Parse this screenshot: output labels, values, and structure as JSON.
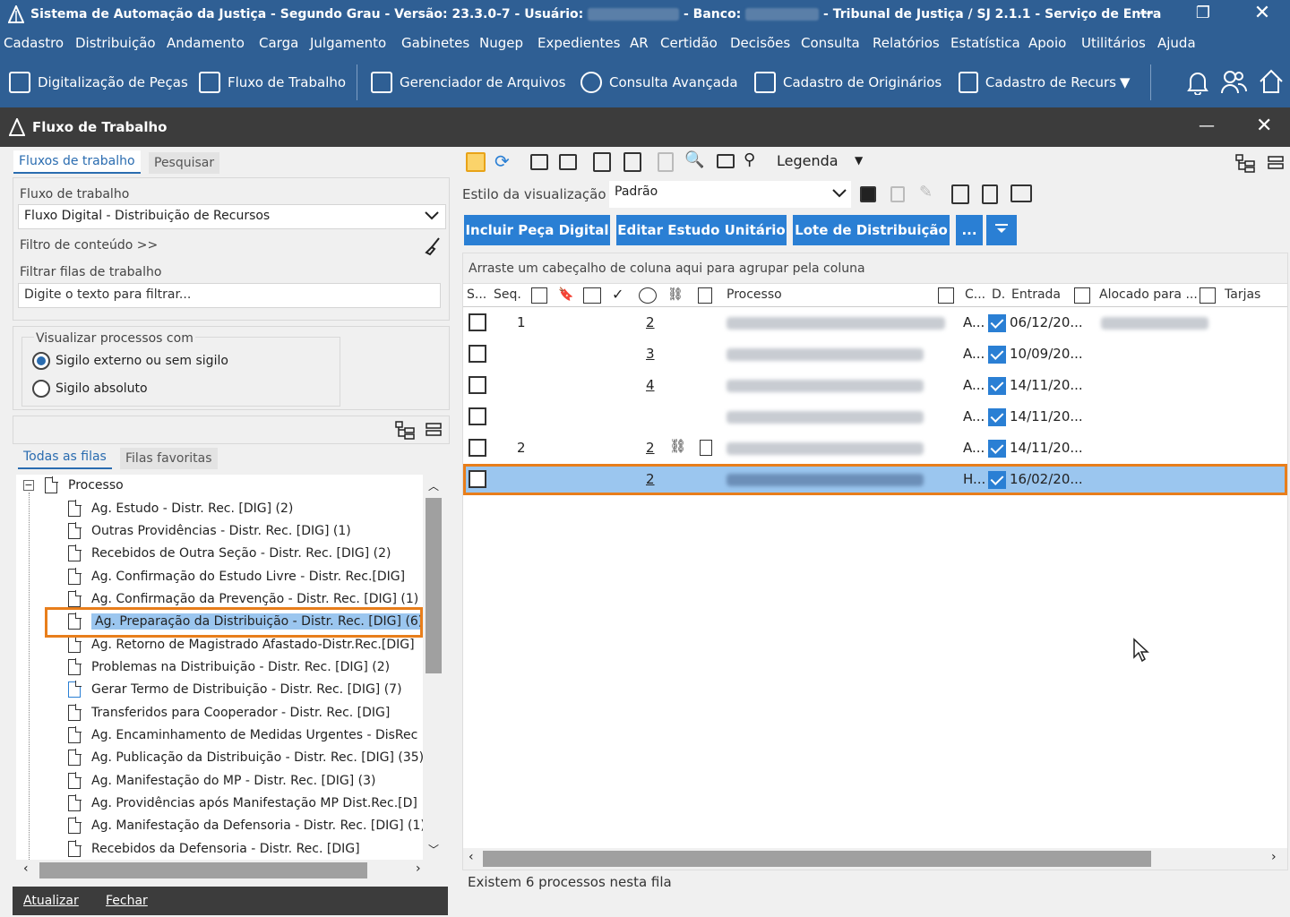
{
  "window": {
    "title_prefix": "Sistema de Automação da Justiça - Segundo Grau - Versão: 23.3.0-7 - Usuário:",
    "title_mid": "- Banco:",
    "title_suffix": "- Tribunal de Justiça / SJ 2.1.1 - Serviço de Entra",
    "minimize": "—",
    "restore": "❐",
    "close": "✕"
  },
  "menu": [
    "Cadastro",
    "Distribuição",
    "Andamento",
    "Carga",
    "Julgamento",
    "Gabinetes",
    "Nugep",
    "Expedientes",
    "AR",
    "Certidão",
    "Decisões",
    "Consulta",
    "Relatórios",
    "Estatística",
    "Apoio",
    "Utilitários",
    "Ajuda"
  ],
  "toolbar": {
    "items": [
      "Digitalização de Peças",
      "Fluxo de Trabalho",
      "Gerenciador de Arquivos",
      "Consulta Avançada",
      "Cadastro de Originários",
      "Cadastro de Recurs"
    ],
    "more": "▼"
  },
  "panel": {
    "title": "Fluxo de Trabalho",
    "min": "—",
    "close": "✕"
  },
  "left": {
    "tabs": [
      "Fluxos de trabalho",
      "Pesquisar"
    ],
    "fluxo_label": "Fluxo de trabalho",
    "fluxo_value": "Fluxo Digital - Distribuição de Recursos",
    "filtro_conteudo": "Filtro de conteúdo >>",
    "filtrar_label": "Filtrar filas de trabalho",
    "filtrar_placeholder": "Digite o texto para filtrar...",
    "visualizar_label": "Visualizar processos com",
    "radio1": "Sigilo externo ou sem sigilo",
    "radio2": "Sigilo absoluto",
    "queue_tabs": [
      "Todas as filas",
      "Filas favoritas"
    ],
    "tree_root": "Processo",
    "tree_items": [
      "Ag. Estudo - Distr. Rec. [DIG] (2)",
      "Outras Providências - Distr. Rec. [DIG] (1)",
      "Recebidos de Outra Seção - Distr. Rec. [DIG] (2)",
      "Ag. Confirmação do Estudo Livre - Distr. Rec.[DIG]",
      "Ag. Confirmação da Prevenção - Distr. Rec. [DIG] (1)",
      "Ag. Preparação da Distribuição - Distr. Rec. [DIG] (6)",
      "Ag. Retorno de Magistrado Afastado-Distr.Rec.[DIG]",
      "Problemas na Distribuição - Distr. Rec. [DIG] (2)",
      "Gerar Termo de Distribuição - Distr. Rec. [DIG] (7)",
      "Transferidos para Cooperador - Distr. Rec. [DIG]",
      "Ag. Encaminhamento de Medidas Urgentes - DisRec",
      "Ag. Publicação da Distribuição - Distr. Rec. [DIG] (35)",
      "Ag. Manifestação do MP - Distr. Rec. [DIG] (3)",
      "Ag. Providências após Manifestação MP Dist.Rec.[D]",
      "Ag. Manifestação da Defensoria - Distr. Rec. [DIG] (1)",
      "Recebidos da Defensoria - Distr. Rec. [DIG]"
    ],
    "footer_buttons": [
      "Atualizar",
      "Fechar"
    ]
  },
  "right": {
    "legenda": "Legenda",
    "estilo_label": "Estilo da visualização",
    "estilo_value": "Padrão",
    "buttons": [
      "Incluir Peça Digital",
      "Editar Estudo Unitário",
      "Lote de Distribuição",
      "..."
    ],
    "group_hint": "Arraste um cabeçalho de coluna aqui para agrupar pela coluna",
    "columns": {
      "s": "S...",
      "seq": "Seq.",
      "processo": "Processo",
      "c": "C...",
      "d": "D.",
      "entrada": "Entrada",
      "alocado": "Alocado para ...",
      "tarjas": "Tarjas"
    },
    "rows": [
      {
        "seq": "1",
        "num": "2",
        "c": "A...",
        "entrada": "06/12/20..."
      },
      {
        "seq": "",
        "num": "3",
        "c": "A...",
        "entrada": "10/09/20..."
      },
      {
        "seq": "",
        "num": "4",
        "c": "A...",
        "entrada": "14/11/20..."
      },
      {
        "seq": "",
        "num": "",
        "c": "A...",
        "entrada": "14/11/20..."
      },
      {
        "seq": "2",
        "num": "2",
        "c": "A...",
        "entrada": "14/11/20..."
      },
      {
        "seq": "",
        "num": "2",
        "c": "H...",
        "entrada": "16/02/20..."
      }
    ],
    "status": "Existem 6 processos nesta fila"
  }
}
